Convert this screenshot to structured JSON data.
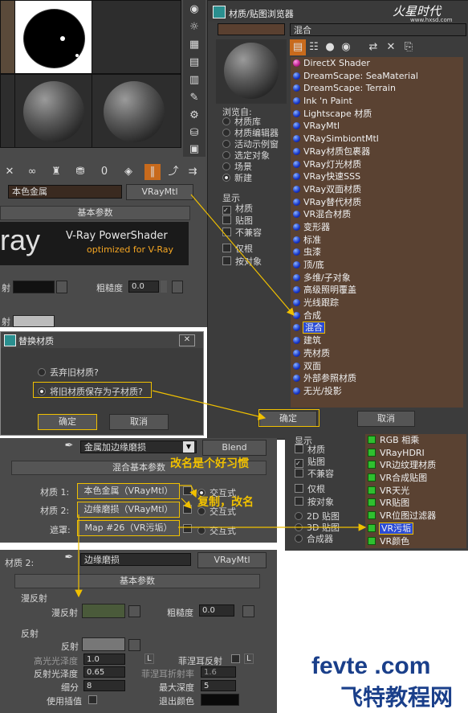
{
  "material_editor": {
    "material_name": "本色金属",
    "material_type": "VRayMtl",
    "rollout_basic": "基本参数",
    "vray_banner_logo": "ray",
    "vray_banner_title": "V-Ray PowerShader",
    "vray_banner_subtitle": "optimized for V-Ray",
    "roughness_label": "粗糙度",
    "roughness_value": "0.0",
    "diffuse_label_partial": "射",
    "reflect_label_partial": "射"
  },
  "browser": {
    "title": "材质/贴图浏览器",
    "search_value": "混合",
    "browse_from_label": "浏览自:",
    "browse_from": [
      {
        "label": "材质库",
        "on": false
      },
      {
        "label": "材质编辑器",
        "on": false
      },
      {
        "label": "活动示例窗",
        "on": false
      },
      {
        "label": "选定对象",
        "on": false
      },
      {
        "label": "场景",
        "on": false
      },
      {
        "label": "新建",
        "on": true
      }
    ],
    "show_label": "显示",
    "show_items": [
      {
        "label": "材质",
        "checked": true
      },
      {
        "label": "贴图",
        "checked": false
      },
      {
        "label": "不兼容",
        "checked": false
      }
    ],
    "root_only": "仅根",
    "by_object": "按对象",
    "list": [
      {
        "label": "DirectX Shader",
        "icon": "magenta"
      },
      {
        "label": "DreamScape: SeaMaterial",
        "icon": "blue"
      },
      {
        "label": "DreamScape: Terrain",
        "icon": "blue"
      },
      {
        "label": "Ink 'n Paint",
        "icon": "blue"
      },
      {
        "label": "Lightscape 材质",
        "icon": "blue"
      },
      {
        "label": "VRayMtl",
        "icon": "blue"
      },
      {
        "label": "VRaySimbiontMtl",
        "icon": "blue"
      },
      {
        "label": "VRay材质包裹器",
        "icon": "blue"
      },
      {
        "label": "VRay灯光材质",
        "icon": "blue"
      },
      {
        "label": "VRay快速SSS",
        "icon": "blue"
      },
      {
        "label": "VRay双面材质",
        "icon": "blue"
      },
      {
        "label": "VRay替代材质",
        "icon": "blue"
      },
      {
        "label": "VR混合材质",
        "icon": "blue"
      },
      {
        "label": "变形器",
        "icon": "blue"
      },
      {
        "label": "标准",
        "icon": "blue"
      },
      {
        "label": "虫漆",
        "icon": "blue"
      },
      {
        "label": "顶/底",
        "icon": "blue"
      },
      {
        "label": "多维/子对象",
        "icon": "blue"
      },
      {
        "label": "高级照明覆盖",
        "icon": "blue"
      },
      {
        "label": "光线跟踪",
        "icon": "blue"
      },
      {
        "label": "合成",
        "icon": "blue"
      },
      {
        "label": "混合",
        "icon": "blue",
        "selected": true
      },
      {
        "label": "建筑",
        "icon": "blue"
      },
      {
        "label": "壳材质",
        "icon": "blue"
      },
      {
        "label": "双面",
        "icon": "blue"
      },
      {
        "label": "外部参照材质",
        "icon": "blue"
      },
      {
        "label": "无光/投影",
        "icon": "blue"
      }
    ],
    "ok_label": "确定",
    "cancel_label": "取消"
  },
  "replace_dialog": {
    "title": "替换材质",
    "option_discard": "丢弃旧材质?",
    "option_keep": "将旧材质保存为子材质?",
    "ok_label": "确定",
    "cancel_label": "取消"
  },
  "blend_panel": {
    "material_name": "金属加边缘磨损",
    "material_type": "Blend",
    "rollout": "混合基本参数",
    "mat1_label": "材质 1:",
    "mat1_value": "本色金属（VRayMtl）",
    "mat2_label": "材质 2:",
    "mat2_value": "边缘磨损（VRayMtl）",
    "mask_label": "遮罩:",
    "mask_value": "Map #26（VR污垢）",
    "interactive": "交互式"
  },
  "annotations": {
    "rename_tip": "改名是个好习惯",
    "copy_rename_tip": "复制，改名"
  },
  "map_browser": {
    "show_label": "显示",
    "show_items": [
      {
        "label": "材质",
        "checked": false
      },
      {
        "label": "贴图",
        "checked": true
      },
      {
        "label": "不兼容",
        "checked": false
      }
    ],
    "root_only": "仅根",
    "by_object": "按对象",
    "types": [
      {
        "label": "2D 贴图",
        "on": false
      },
      {
        "label": "3D 贴图",
        "on": false
      },
      {
        "label": "合成器",
        "on": false
      }
    ],
    "list": [
      {
        "label": "RGB 相乘"
      },
      {
        "label": "VRayHDRI"
      },
      {
        "label": "VR边纹理材质"
      },
      {
        "label": "VR合成贴图"
      },
      {
        "label": "VR天光"
      },
      {
        "label": "VR贴图"
      },
      {
        "label": "VR位图过滤器"
      },
      {
        "label": "VR污垢",
        "selected": true
      },
      {
        "label": "VR颜色"
      }
    ]
  },
  "mat2_panel": {
    "label": "材质 2:",
    "name": "边缘磨损",
    "type": "VRayMtl",
    "rollout": "基本参数",
    "diffuse_group": "漫反射",
    "diffuse_label": "漫反射",
    "roughness_label": "粗糙度",
    "roughness_value": "0.0",
    "reflect_group": "反射",
    "reflect_label": "反射",
    "hilight_gloss_label": "高光光泽度",
    "hilight_gloss_value": "1.0",
    "fresnel_label": "菲涅耳反射",
    "refl_gloss_label": "反射光泽度",
    "refl_gloss_value": "0.65",
    "fresnel_ior_label": "菲涅耳折射率",
    "fresnel_ior_value": "1.6",
    "subdivs_label": "细分",
    "subdivs_value": "8",
    "max_depth_label": "最大深度",
    "max_depth_value": "5",
    "use_interp_label": "使用插值",
    "exit_color_label": "退出颜色",
    "lock_letter": "L",
    "diffuse_color": "#4a5a3a",
    "reflect_color": "#777777",
    "exit_color": "#0a0a0a"
  },
  "watermark": {
    "top_brand": "火星时代",
    "top_url": "www.hxsd.com",
    "bottom_brand": "fevte .com",
    "bottom_cn": "飞特教程网"
  },
  "colors": {
    "accent_yellow": "#f0c000",
    "orange_text": "#f5a623",
    "browser_bg": "#5a4232",
    "selection_blue": "#2a4bd7"
  }
}
